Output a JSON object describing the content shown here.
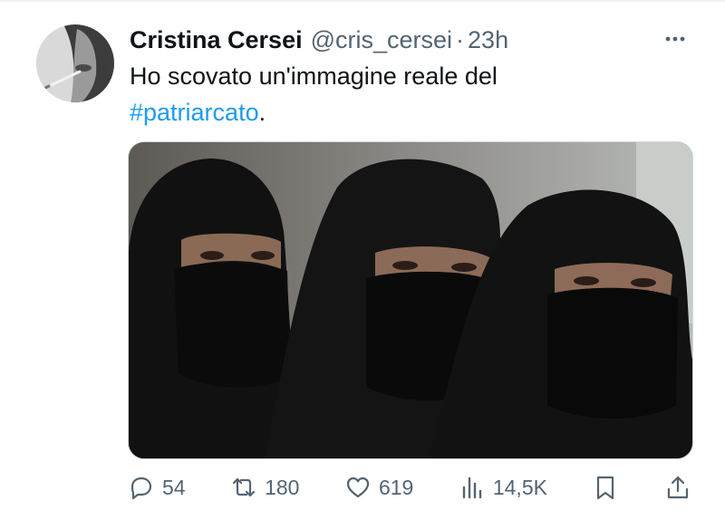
{
  "tweet": {
    "display_name": "Cristina Cersei",
    "handle": "@cris_cersei",
    "separator": "·",
    "time": "23h",
    "text_main": "Ho scovato un'immagine reale del",
    "hashtag": "#patriarcato",
    "text_end": "."
  },
  "actions": {
    "replies": "54",
    "retweets": "180",
    "likes": "619",
    "views": "14,5K"
  },
  "colors": {
    "link": "#1d9bf0",
    "secondary_text": "#536471",
    "primary_text": "#0f1419"
  },
  "icons": [
    "more-icon",
    "reply-icon",
    "retweet-icon",
    "like-icon",
    "views-icon",
    "bookmark-icon",
    "share-icon"
  ]
}
